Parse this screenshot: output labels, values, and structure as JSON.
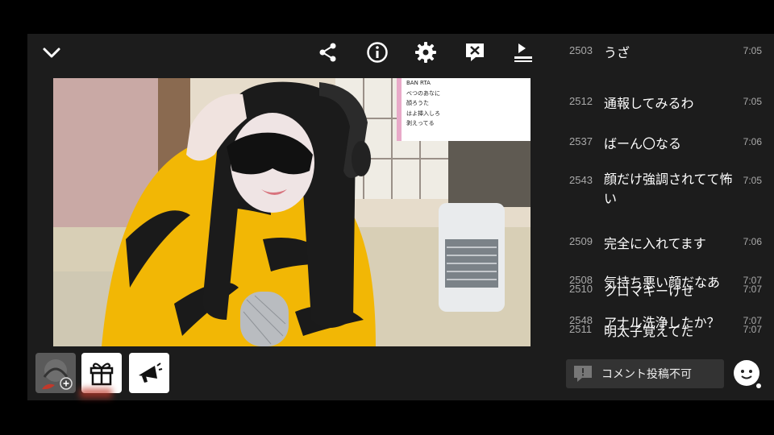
{
  "overlay_comments": [
    "BAN RTA",
    "べつのあなに",
    "顔ろうた",
    "はよ挿入しろ",
    "剥えってる"
  ],
  "comments": [
    {
      "num": "2503",
      "text": "うざ",
      "time": "7:05"
    },
    {
      "num": "2512",
      "text": "通報してみるわ",
      "time": "7:05"
    },
    {
      "num": "2537",
      "text": "ばーん〇なる",
      "time": "7:06"
    },
    {
      "num": "2543",
      "text": "顔だけ強調されてて怖い",
      "time": "7:05"
    },
    {
      "num": "2509",
      "text": "完全に入れてます",
      "time": "7:06"
    },
    {
      "num": "2508",
      "text": "気持ち悪い顔だなあ",
      "time": "7:07"
    },
    {
      "num": "2510",
      "text": "クロマキーけせ",
      "time": "7:07"
    },
    {
      "num": "2548",
      "text": "アナル洗浄したか？",
      "time": "7:07"
    },
    {
      "num": "2511",
      "text": "明太子覚えてた",
      "time": "7:07"
    }
  ],
  "comment_input": {
    "label": "コメント投稿不可"
  },
  "icons": {
    "collapse": "chevron-down-icon",
    "share": "share-icon",
    "info": "info-icon",
    "settings": "gear-icon",
    "hide_comments": "comment-off-icon",
    "playlist": "playlist-icon",
    "gift": "gift-icon",
    "announce": "megaphone-icon",
    "emoji": "smiley-face-icon"
  },
  "colors": {
    "panel_bg": "#1c1c1c",
    "overlay_border": "#e8a9c8",
    "muted_text": "#a9a9a9"
  }
}
